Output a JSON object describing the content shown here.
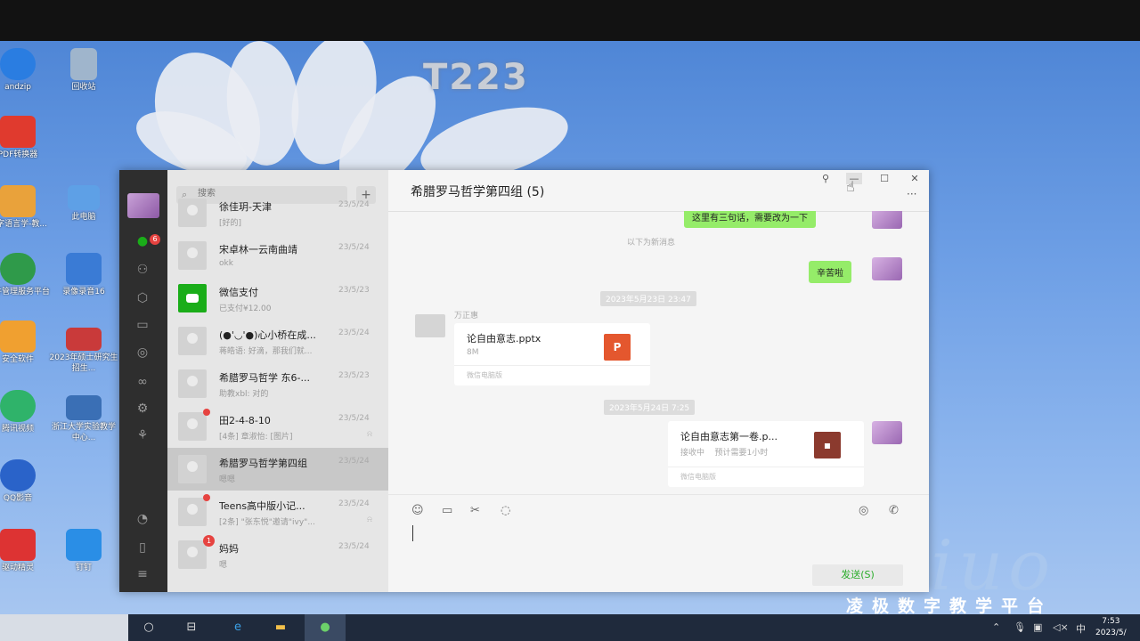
{
  "desktop": {
    "watermark": "T223",
    "platform_label": "凌极数字教学平台",
    "brand_script": "iuo",
    "icons": [
      {
        "label": "andzip",
        "color": "#2a7de1"
      },
      {
        "label": "回收站",
        "color": "#9fb5cc"
      },
      {
        "label": "PDF转换器",
        "color": "#e03a2e"
      },
      {
        "label": "数字语言学-教...",
        "color": "#e9a23b"
      },
      {
        "label": "此电脑",
        "color": "#5ea0e6"
      },
      {
        "label": "文件管理服务平台",
        "color": "#2f9a4a"
      },
      {
        "label": "录像录音16",
        "color": "#3a7bd5"
      },
      {
        "label": "安全软件",
        "color": "#f0a030"
      },
      {
        "label": "2023年硕士研究生招生...",
        "color": "#c93a3a"
      },
      {
        "label": "腾讯视频",
        "color": "#2fb36a"
      },
      {
        "label": "浙江大学实验教学中心...",
        "color": "#3a6fb5"
      },
      {
        "label": "QQ影音",
        "color": "#2a63c9"
      },
      {
        "label": "驱动精灵",
        "color": "#d33"
      },
      {
        "label": "钉钉",
        "color": "#2a8ee6"
      }
    ]
  },
  "wechat": {
    "nav": {
      "unread_badge": "6"
    },
    "search": {
      "placeholder": "搜索"
    },
    "add_label": "+",
    "chats": [
      {
        "name": "徐佳玥-天津",
        "time": "23/5/24",
        "preview": "[好的]",
        "dot": false,
        "badge": "",
        "mute": false,
        "pay": false
      },
      {
        "name": "宋卓林一云南曲靖",
        "time": "23/5/24",
        "preview": "okk",
        "dot": false,
        "badge": "",
        "mute": false,
        "pay": false
      },
      {
        "name": "微信支付",
        "time": "23/5/23",
        "preview": "已支付¥12.00",
        "dot": false,
        "badge": "",
        "mute": false,
        "pay": true
      },
      {
        "name": "(●'◡'●)心小桥在成...",
        "time": "23/5/24",
        "preview": "蒋皓语: 好滴，那我们就...",
        "dot": false,
        "badge": "",
        "mute": false,
        "pay": false
      },
      {
        "name": "希腊罗马哲学 东6-...",
        "time": "23/5/23",
        "preview": "助教xbl: 对的",
        "dot": false,
        "badge": "",
        "mute": false,
        "pay": false
      },
      {
        "name": "田2-4-8-10",
        "time": "23/5/24",
        "preview": "[4条] 章淑怡: [图片]",
        "dot": true,
        "badge": "",
        "mute": true,
        "pay": false
      },
      {
        "name": "希腊罗马哲学第四组",
        "time": "23/5/24",
        "preview": "嗯嗯",
        "dot": false,
        "badge": "",
        "mute": false,
        "pay": false,
        "selected": true
      },
      {
        "name": "Teens高中版小记...",
        "time": "23/5/24",
        "preview": "[2条] \"张东悦\"邀请\"ivy\"...",
        "dot": true,
        "badge": "",
        "mute": true,
        "pay": false
      },
      {
        "name": "妈妈",
        "time": "23/5/24",
        "preview": "嗯",
        "dot": false,
        "badge": "1",
        "mute": false,
        "pay": false
      }
    ],
    "chat": {
      "title": "希腊罗马哲学第四组 (5)",
      "top_bubble": "这里有三句话，需要改为一下",
      "new_msg_divider": "以下为新消息",
      "bubble_1": "辛苦啦",
      "time_1": "2023年5月23日 23:47",
      "sender_1": "万正惠",
      "file_1": {
        "name": "论自由意志.pptx",
        "size": "8M",
        "footer": "微信电脑版",
        "icon": "P",
        "icon_color": "#e4572e"
      },
      "time_2": "2023年5月24日 7:25",
      "file_2": {
        "name": "论自由意志第一卷.p...",
        "status": "接收中",
        "eta": "预计需要1小时",
        "footer": "微信电脑版",
        "icon": "▪",
        "icon_color": "#8b3a2e"
      },
      "send_label": "发送(S)"
    },
    "window_controls": {
      "pin": "⚲",
      "minimize": "—",
      "maximize": "☐",
      "close": "✕",
      "more": "···"
    }
  },
  "taskbar": {
    "clock_time": "7:53",
    "clock_date": "2023/5/",
    "ime": "中"
  }
}
